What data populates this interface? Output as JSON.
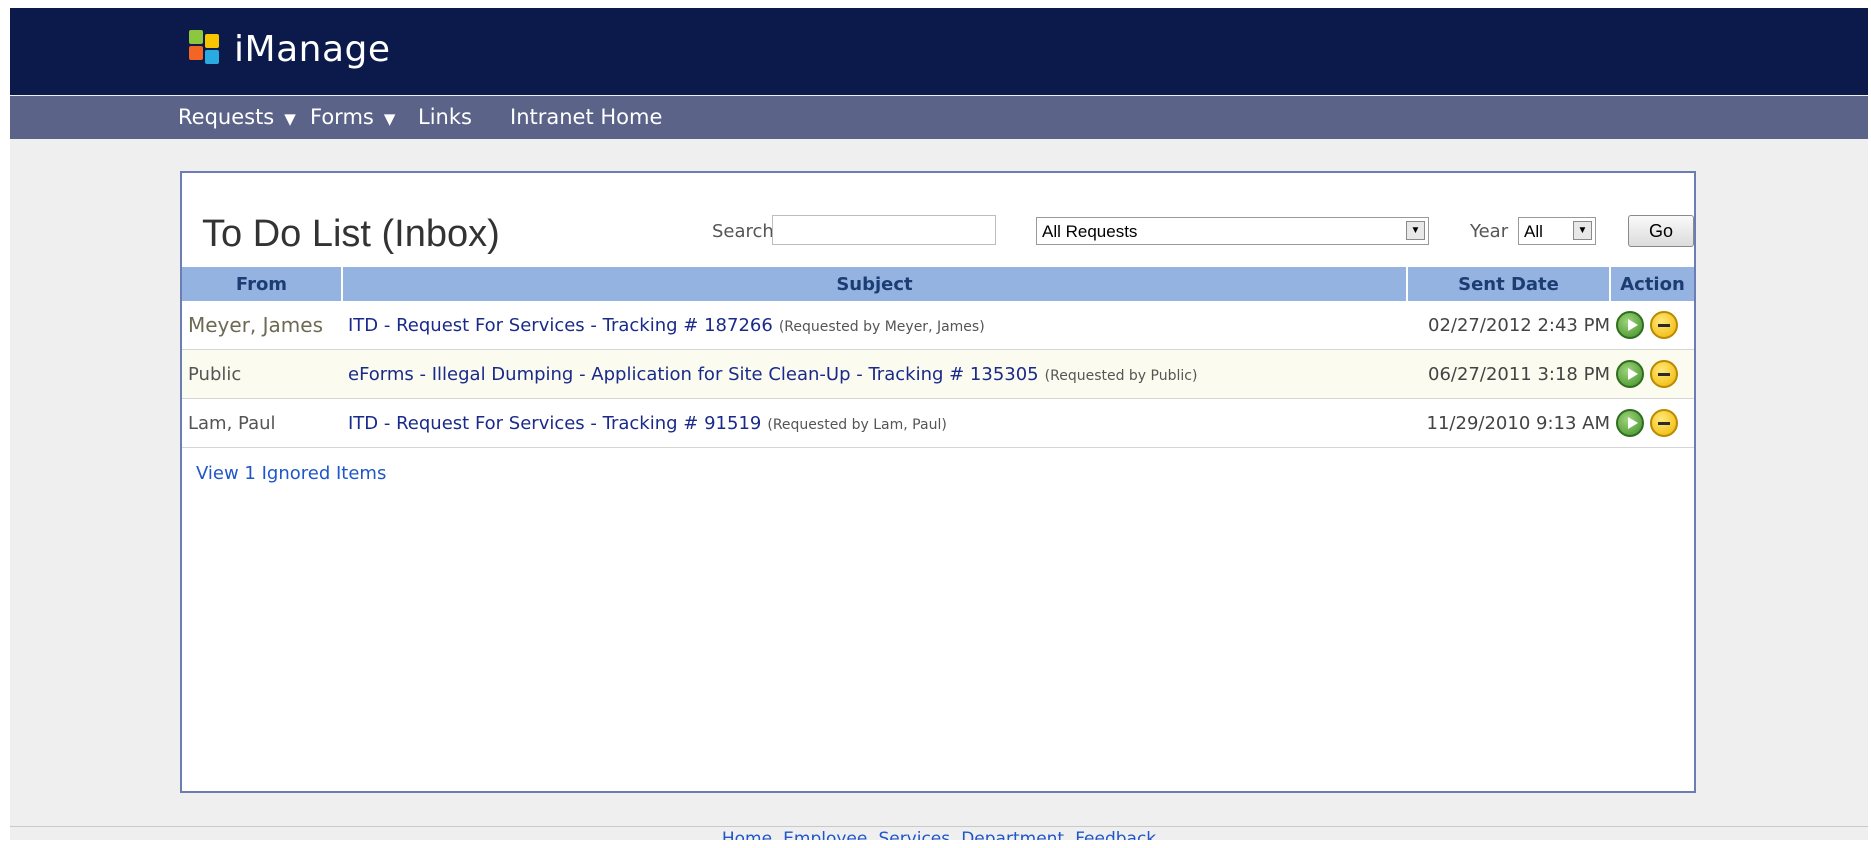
{
  "app": {
    "name": "iManage"
  },
  "nav": {
    "items": [
      {
        "label": "Requests"
      },
      {
        "label": "Forms"
      },
      {
        "label": "Links"
      },
      {
        "label": "Intranet Home"
      }
    ]
  },
  "panel": {
    "title": "To Do List (Inbox)",
    "search_label": "Search",
    "search_value": "",
    "filter_value": "All Requests",
    "year_label": "Year",
    "year_value": "All",
    "go_label": "Go"
  },
  "table": {
    "headers": [
      "From",
      "Subject",
      "Sent Date",
      "Action"
    ],
    "rows": [
      {
        "from": "Meyer, James",
        "subject": "ITD - Request For Services - Tracking #  187266",
        "requested_prefix": "(Requested by",
        "requested_name": "Meyer, James",
        "requested_suffix": ")",
        "sent": "02/27/2012 2:43 PM"
      },
      {
        "from": "Public",
        "subject": "eForms - Illegal Dumping - Application for Site Clean-Up - Tracking # 135305",
        "requested_prefix": "(Requested by Public)",
        "requested_name": "",
        "requested_suffix": "",
        "sent": "06/27/2011 3:18 PM"
      },
      {
        "from": "Lam, Paul",
        "subject": "ITD - Request For Services - Tracking # 91519",
        "requested_prefix": "(Requested by Lam, Paul)",
        "requested_name": "",
        "requested_suffix": "",
        "sent": "11/29/2010 9:13 AM"
      }
    ]
  },
  "ignored_link": "View 1 Ignored Items",
  "footer": {
    "links": [
      "Home",
      "Employee",
      "Services",
      "Department",
      "Feedback"
    ]
  },
  "colors": {
    "topbar": "#0b1a4a",
    "navbar": "#5b6389",
    "table_header": "#95b3e0",
    "link": "#1f56c8"
  }
}
